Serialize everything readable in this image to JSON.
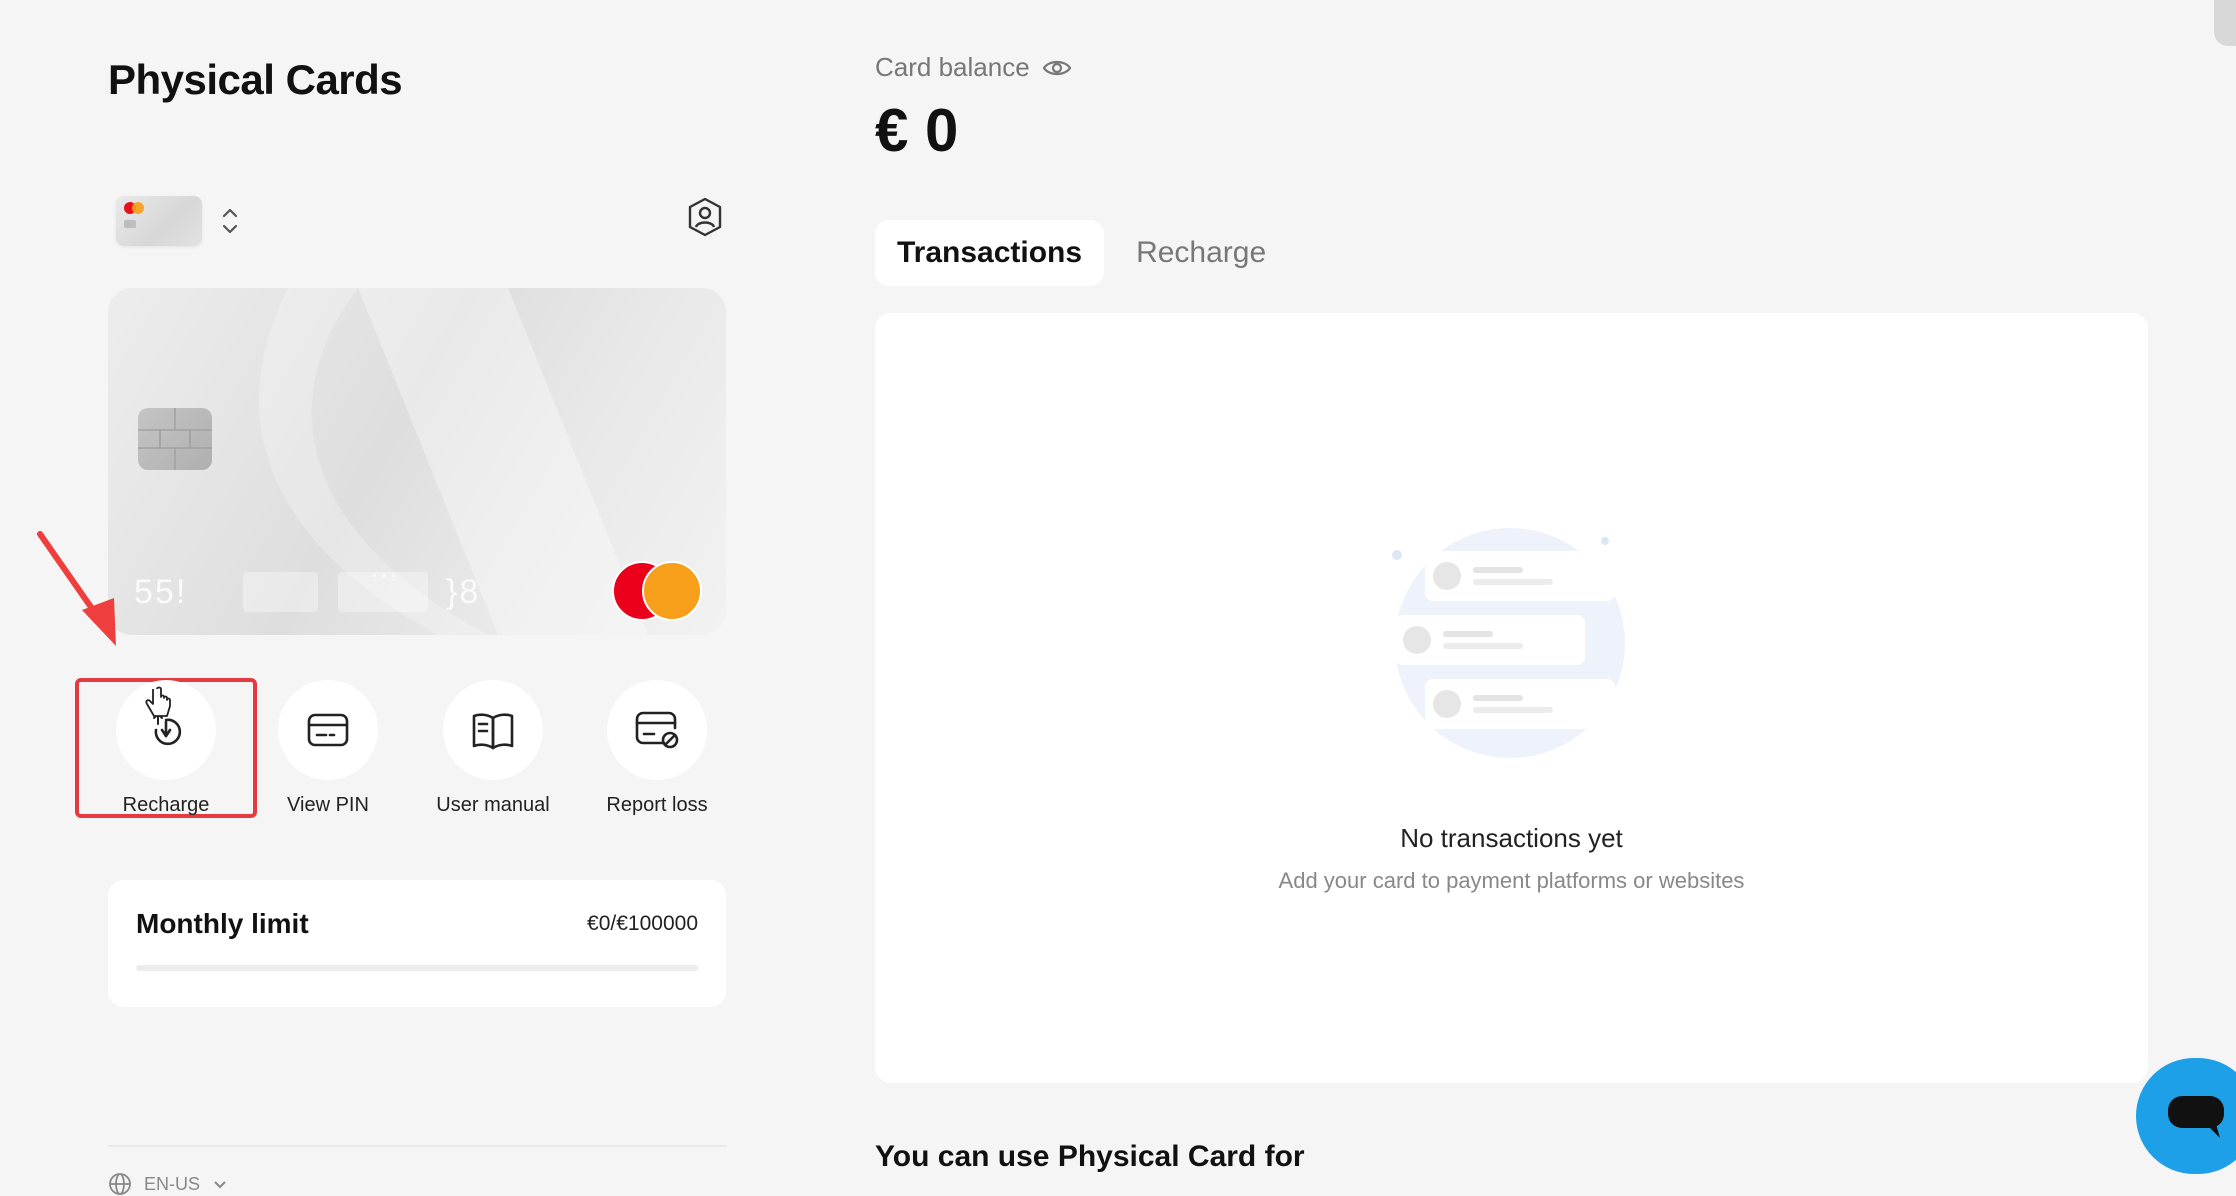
{
  "page": {
    "title": "Physical Cards"
  },
  "card": {
    "number_start": "55!",
    "number_middle": "···",
    "number_end": "}8"
  },
  "actions": [
    {
      "label": "Recharge",
      "icon": "recharge-icon"
    },
    {
      "label": "View PIN",
      "icon": "card-icon"
    },
    {
      "label": "User manual",
      "icon": "book-icon"
    },
    {
      "label": "Report loss",
      "icon": "card-block-icon"
    }
  ],
  "limit": {
    "title": "Monthly limit",
    "value": "€0/€100000",
    "progress": 0
  },
  "language": {
    "label": "EN-US"
  },
  "balance": {
    "label": "Card balance",
    "value": "€ 0"
  },
  "tabs": [
    {
      "label": "Transactions",
      "active": true
    },
    {
      "label": "Recharge",
      "active": false
    }
  ],
  "empty_state": {
    "title": "No transactions yet",
    "subtitle": "Add your card to payment platforms or websites"
  },
  "usage": {
    "title": "You can use Physical Card for"
  },
  "colors": {
    "highlight": "#e33b3f",
    "chat_button": "#1ea0e8",
    "mastercard_red": "#eb001b",
    "mastercard_orange": "#f79e1b"
  }
}
